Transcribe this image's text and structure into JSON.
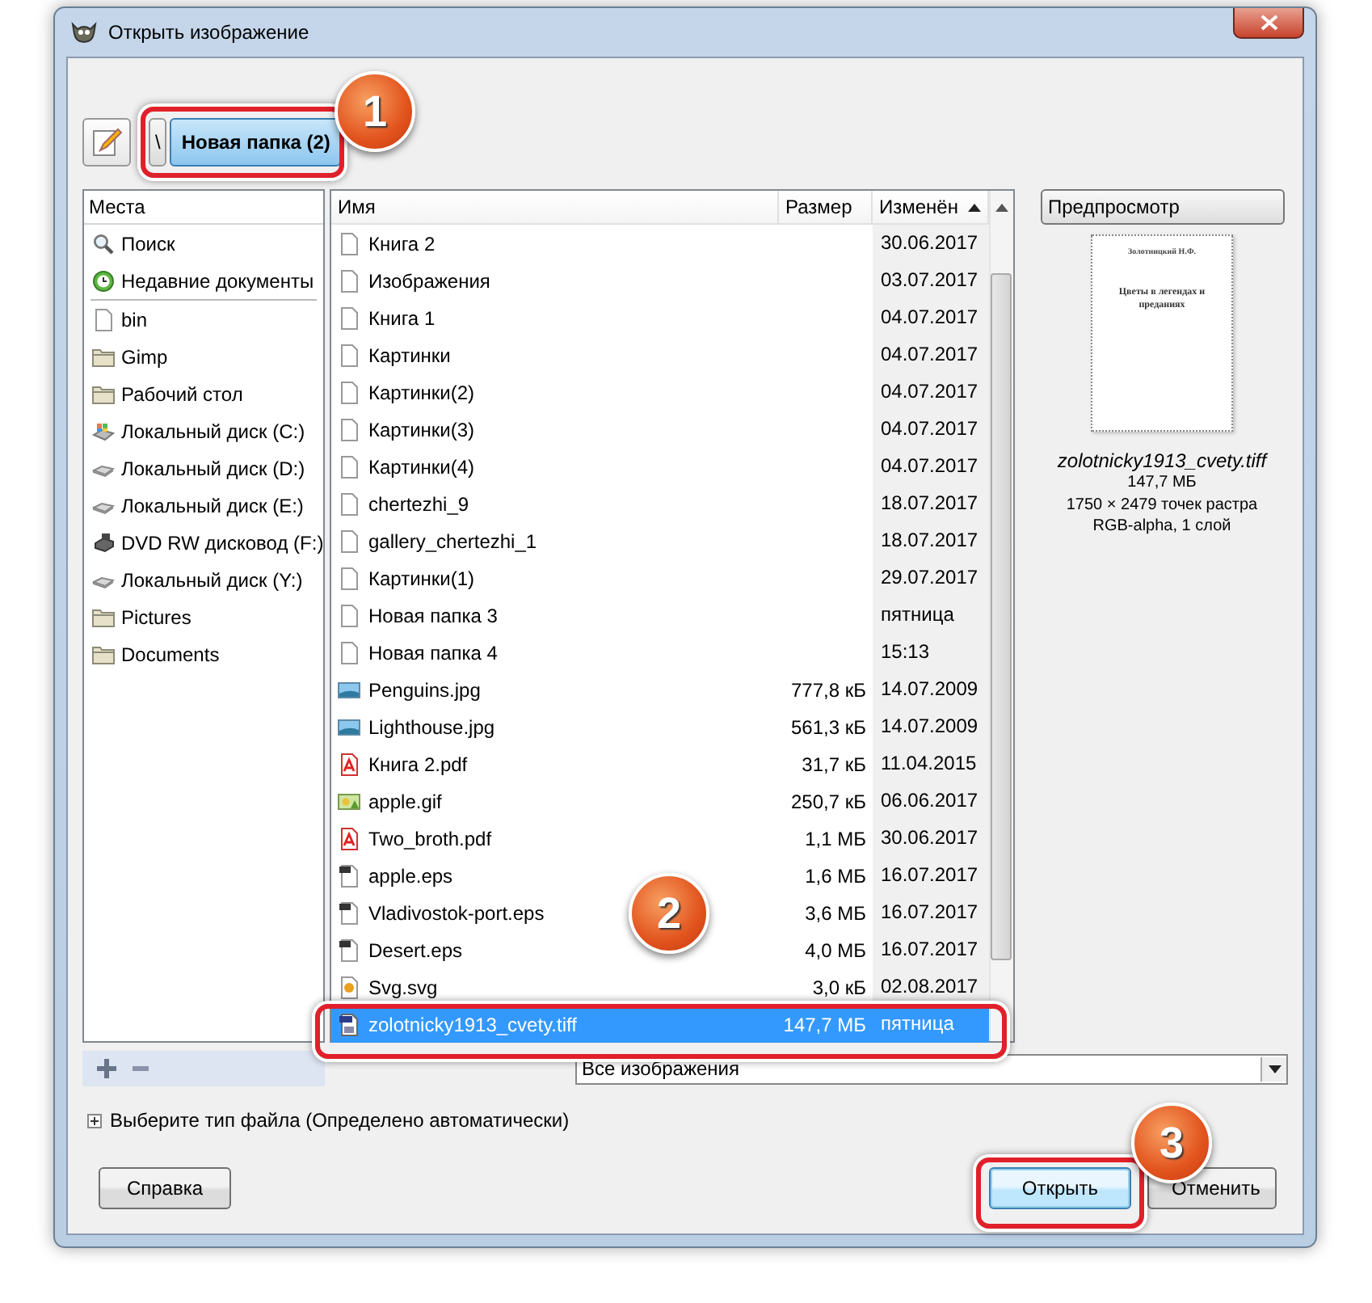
{
  "window": {
    "title": "Открыть изображение"
  },
  "toolbar": {
    "path": [
      {
        "label": "\\",
        "selected": false
      },
      {
        "label": "Новая папка (2)",
        "selected": true
      }
    ]
  },
  "places": {
    "header": "Места",
    "items": [
      {
        "label": "Поиск",
        "kind": "search"
      },
      {
        "label": "Недавние документы",
        "kind": "recent"
      },
      {
        "label": "bin",
        "kind": "file"
      },
      {
        "label": "Gimp",
        "kind": "folder"
      },
      {
        "label": "Рабочий стол",
        "kind": "folder"
      },
      {
        "label": "Локальный диск (C:)",
        "kind": "system"
      },
      {
        "label": "Локальный диск (D:)",
        "kind": "drive"
      },
      {
        "label": "Локальный диск (E:)",
        "kind": "drive"
      },
      {
        "label": "DVD RW дисковод (F:)",
        "kind": "dvd"
      },
      {
        "label": "Локальный диск (Y:)",
        "kind": "drive"
      },
      {
        "label": "Pictures",
        "kind": "folder"
      },
      {
        "label": "Documents",
        "kind": "folder"
      }
    ]
  },
  "files": {
    "columns": [
      {
        "label": "Имя",
        "sorted": false
      },
      {
        "label": "Размер",
        "sorted": false
      },
      {
        "label": "Изменён",
        "sorted": true
      }
    ],
    "rows": [
      {
        "name": "Книга 2",
        "kind": "blank",
        "size": "",
        "date": "30.06.2017",
        "selected": false
      },
      {
        "name": "Изображения",
        "kind": "blank",
        "size": "",
        "date": "03.07.2017",
        "selected": false
      },
      {
        "name": "Книга 1",
        "kind": "blank",
        "size": "",
        "date": "04.07.2017",
        "selected": false
      },
      {
        "name": "Картинки",
        "kind": "blank",
        "size": "",
        "date": "04.07.2017",
        "selected": false
      },
      {
        "name": "Картинки(2)",
        "kind": "blank",
        "size": "",
        "date": "04.07.2017",
        "selected": false
      },
      {
        "name": "Картинки(3)",
        "kind": "blank",
        "size": "",
        "date": "04.07.2017",
        "selected": false
      },
      {
        "name": "Картинки(4)",
        "kind": "blank",
        "size": "",
        "date": "04.07.2017",
        "selected": false
      },
      {
        "name": "chertezhi_9",
        "kind": "blank",
        "size": "",
        "date": "18.07.2017",
        "selected": false
      },
      {
        "name": "gallery_chertezhi_1",
        "kind": "blank",
        "size": "",
        "date": "18.07.2017",
        "selected": false
      },
      {
        "name": "Картинки(1)",
        "kind": "blank",
        "size": "",
        "date": "29.07.2017",
        "selected": false
      },
      {
        "name": "Новая папка 3",
        "kind": "blank",
        "size": "",
        "date": "пятница",
        "selected": false
      },
      {
        "name": "Новая папка 4",
        "kind": "blank",
        "size": "",
        "date": "15:13",
        "selected": false
      },
      {
        "name": "Penguins.jpg",
        "kind": "image",
        "size": "777,8 кБ",
        "date": "14.07.2009",
        "selected": false
      },
      {
        "name": "Lighthouse.jpg",
        "kind": "image",
        "size": "561,3 кБ",
        "date": "14.07.2009",
        "selected": false
      },
      {
        "name": "Книга 2.pdf",
        "kind": "pdf",
        "size": "31,7 кБ",
        "date": "11.04.2015",
        "selected": false
      },
      {
        "name": "apple.gif",
        "kind": "gif",
        "size": "250,7 кБ",
        "date": "06.06.2017",
        "selected": false
      },
      {
        "name": "Two_broth.pdf",
        "kind": "pdf",
        "size": "1,1 МБ",
        "date": "30.06.2017",
        "selected": false
      },
      {
        "name": "apple.eps",
        "kind": "eps",
        "size": "1,6 МБ",
        "date": "16.07.2017",
        "selected": false
      },
      {
        "name": "Vladivostok-port.eps",
        "kind": "eps",
        "size": "3,6 МБ",
        "date": "16.07.2017",
        "selected": false
      },
      {
        "name": "Desert.eps",
        "kind": "eps",
        "size": "4,0 МБ",
        "date": "16.07.2017",
        "selected": false
      },
      {
        "name": "Svg.svg",
        "kind": "svg",
        "size": "3,0 кБ",
        "date": "02.08.2017",
        "selected": false
      },
      {
        "name": "zolotnicky1913_cvety.tiff",
        "kind": "tiff",
        "size": "147,7 МБ",
        "date": "пятница",
        "selected": true
      }
    ]
  },
  "preview": {
    "button": "Предпросмотр",
    "page_author": "Золотницкий Н.Ф.",
    "page_title": "Цветы в легендах и преданиях",
    "filename": "zolotnicky1913_cvety.tiff",
    "info": [
      "147,7 МБ",
      "1750 × 2479 точек растра",
      "RGB-alpha, 1 слой"
    ]
  },
  "filter": {
    "value": "Все изображения"
  },
  "file_type": {
    "label": "Выберите тип файла (Определено автоматически)",
    "expanded": false
  },
  "buttons": [
    {
      "label": "Справка",
      "kind": "help",
      "focused": false
    },
    {
      "label": "Открыть",
      "kind": "open",
      "focused": true
    },
    {
      "label": "Отменить",
      "kind": "cancel",
      "focused": false
    }
  ],
  "callouts": [
    {
      "label": "1"
    },
    {
      "label": "2"
    },
    {
      "label": "3"
    }
  ]
}
